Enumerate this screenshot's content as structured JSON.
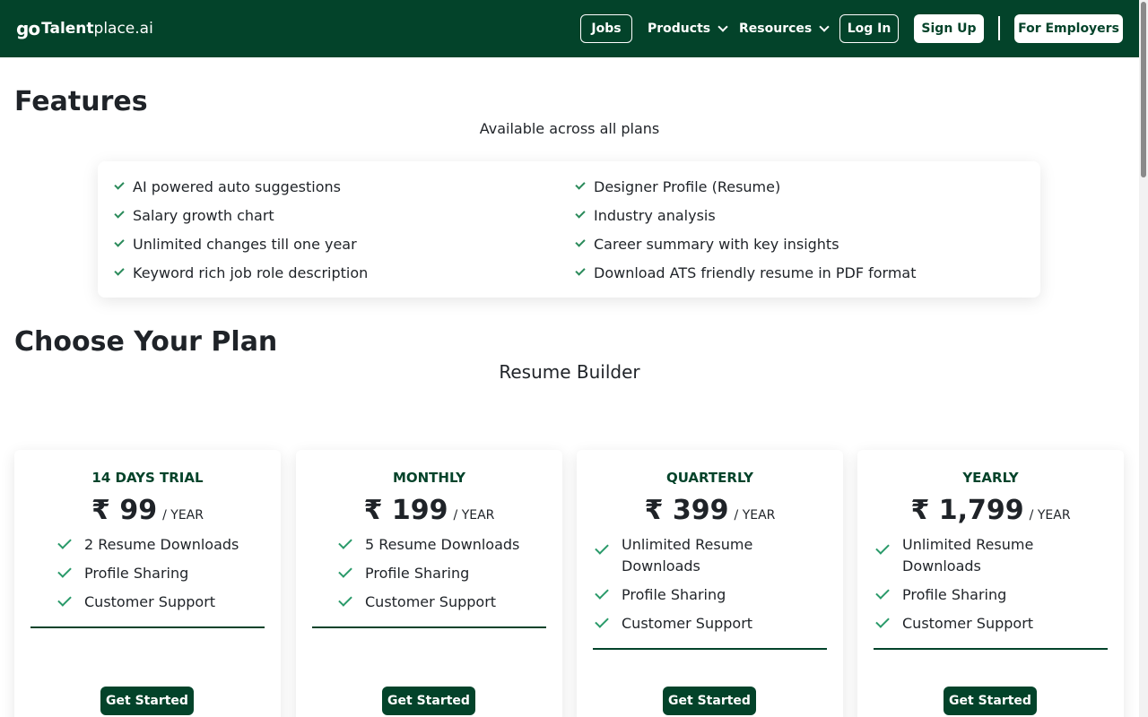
{
  "header": {
    "logo_go": "go",
    "logo_name": "Talent",
    "logo_suffix": "place.ai",
    "nav": {
      "jobs": "Jobs",
      "products": "Products",
      "resources": "Resources",
      "login": "Log In",
      "signup": "Sign Up",
      "employers": "For Employers"
    }
  },
  "features": {
    "title": "Features",
    "subtitle": "Available across all plans",
    "left": [
      "AI powered auto suggestions",
      "Salary growth chart",
      "Unlimited changes till one year",
      "Keyword rich job role description"
    ],
    "right": [
      "Designer Profile (Resume)",
      "Industry analysis",
      "Career summary with key insights",
      "Download ATS friendly resume in PDF format"
    ]
  },
  "plans": {
    "title": "Choose Your Plan",
    "subtitle": "Resume Builder",
    "cards": [
      {
        "name": "14 DAYS TRIAL",
        "price": "₹ 99",
        "period": "/ YEAR",
        "features": [
          "2 Resume Downloads",
          "Profile Sharing",
          "Customer Support"
        ],
        "button": "Get Started"
      },
      {
        "name": "MONTHLY",
        "price": "₹ 199",
        "period": "/ YEAR",
        "features": [
          "5 Resume Downloads",
          "Profile Sharing",
          "Customer Support"
        ],
        "button": "Get Started"
      },
      {
        "name": "QUARTERLY",
        "price": "₹ 399",
        "period": "/ YEAR",
        "features": [
          "Unlimited Resume Downloads",
          "Profile Sharing",
          "Customer Support"
        ],
        "button": "Get Started"
      },
      {
        "name": "YEARLY",
        "price": "₹ 1,799",
        "period": "/ YEAR",
        "features": [
          "Unlimited Resume Downloads",
          "Profile Sharing",
          "Customer Support"
        ],
        "button": "Get Started"
      }
    ]
  },
  "colors": {
    "brand_green": "#03432a",
    "check_green": "#2a9a6a"
  }
}
